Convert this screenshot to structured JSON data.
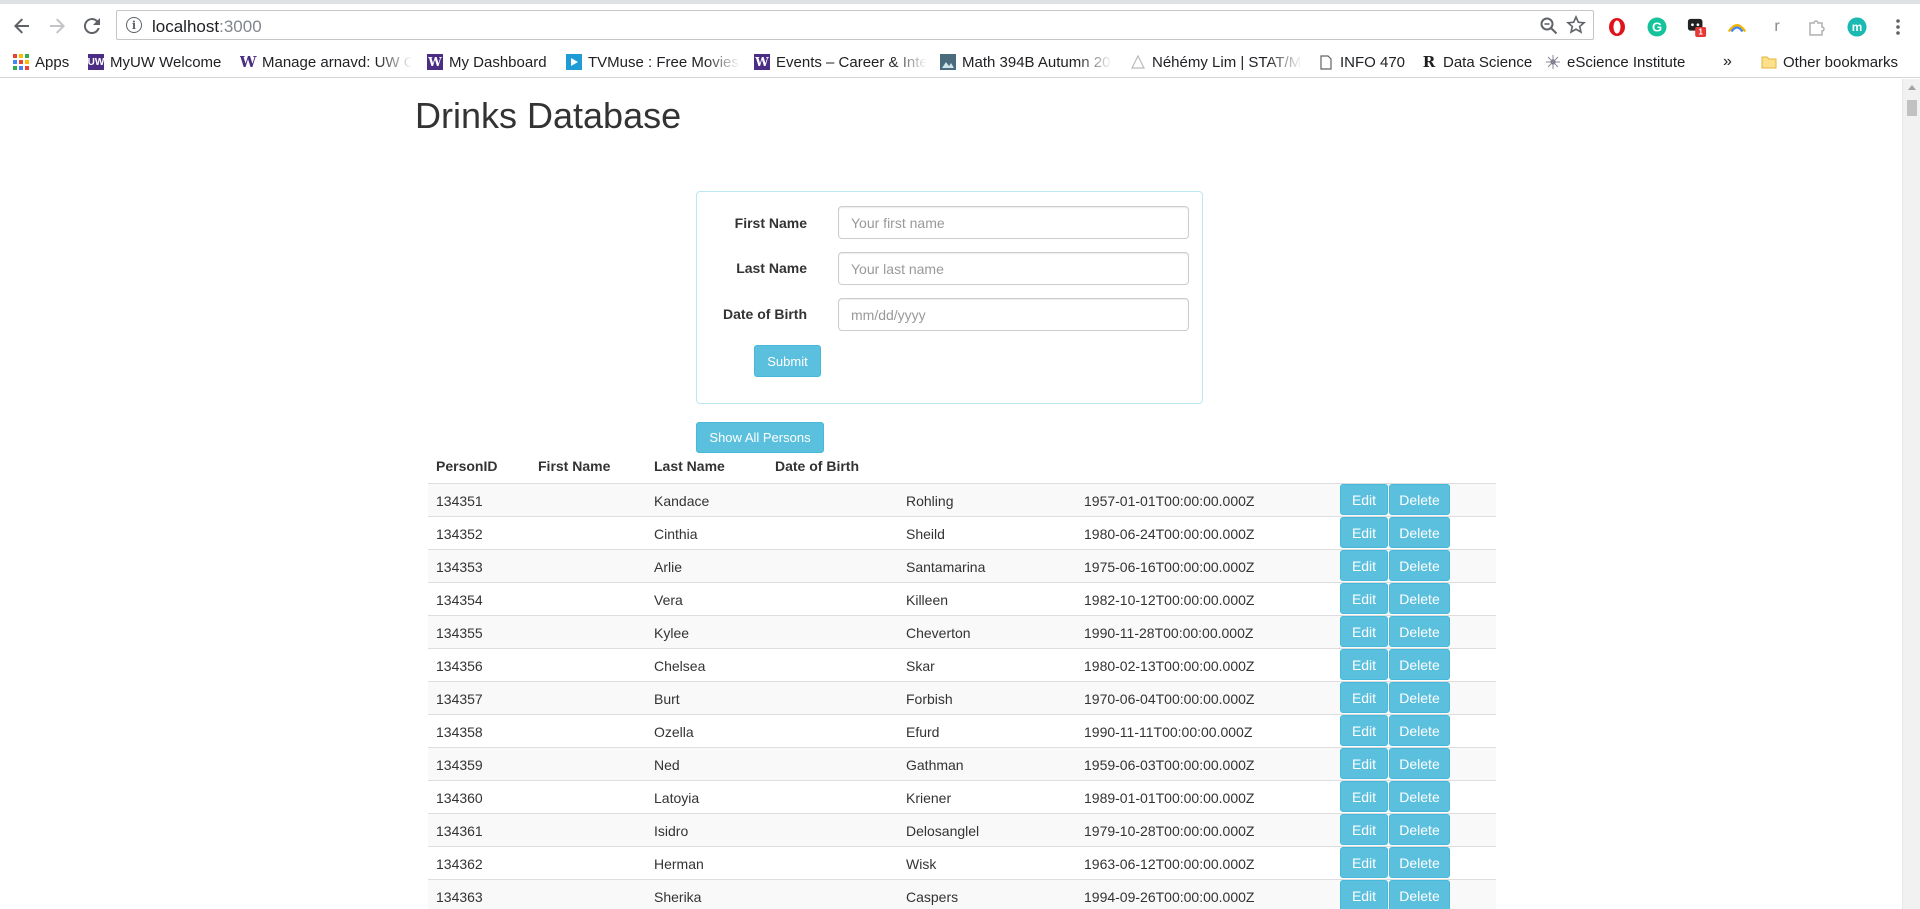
{
  "browser": {
    "url_host": "localhost",
    "url_port": ":3000",
    "bookmarks": [
      {
        "label": "Apps",
        "icon": "apps-grid-icon"
      },
      {
        "label": "MyUW Welcome",
        "icon": "uw-icon"
      },
      {
        "label": "Manage arnavd: UW C",
        "icon": "w-icon"
      },
      {
        "label": "My Dashboard",
        "icon": "w-icon"
      },
      {
        "label": "TVMuse : Free Movies",
        "icon": "play-icon"
      },
      {
        "label": "Events – Career & Inte",
        "icon": "w-icon"
      },
      {
        "label": "Math 394B Autumn 20",
        "icon": "image-icon"
      },
      {
        "label": "Néhémy Lim | STAT/M",
        "icon": "triangle-icon"
      },
      {
        "label": "INFO 470",
        "icon": "page-icon"
      },
      {
        "label": "Data Science",
        "icon": "r-icon"
      },
      {
        "label": "eScience Institute",
        "icon": "escience-icon"
      }
    ],
    "overflow_label": "»",
    "other_bookmarks": "Other bookmarks",
    "extension_badge": "1"
  },
  "page": {
    "title": "Drinks Database"
  },
  "form": {
    "first_name_label": "First Name",
    "first_name_placeholder": "Your first name",
    "last_name_label": "Last Name",
    "last_name_placeholder": "Your last name",
    "dob_label": "Date of Birth",
    "dob_placeholder": "mm/dd/yyyy",
    "submit_label": "Submit"
  },
  "show_all_label": "Show All Persons",
  "table": {
    "headers": [
      "PersonID",
      "First Name",
      "Last Name",
      "Date of Birth"
    ],
    "edit_label": "Edit",
    "delete_label": "Delete",
    "rows": [
      {
        "id": "134351",
        "first": "Kandace",
        "last": "Rohling",
        "dob": "1957-01-01T00:00:00.000Z"
      },
      {
        "id": "134352",
        "first": "Cinthia",
        "last": "Sheild",
        "dob": "1980-06-24T00:00:00.000Z"
      },
      {
        "id": "134353",
        "first": "Arlie",
        "last": "Santamarina",
        "dob": "1975-06-16T00:00:00.000Z"
      },
      {
        "id": "134354",
        "first": "Vera",
        "last": "Killeen",
        "dob": "1982-10-12T00:00:00.000Z"
      },
      {
        "id": "134355",
        "first": "Kylee",
        "last": "Cheverton",
        "dob": "1990-11-28T00:00:00.000Z"
      },
      {
        "id": "134356",
        "first": "Chelsea",
        "last": "Skar",
        "dob": "1980-02-13T00:00:00.000Z"
      },
      {
        "id": "134357",
        "first": "Burt",
        "last": "Forbish",
        "dob": "1970-06-04T00:00:00.000Z"
      },
      {
        "id": "134358",
        "first": "Ozella",
        "last": "Efurd",
        "dob": "1990-11-11T00:00:00.000Z"
      },
      {
        "id": "134359",
        "first": "Ned",
        "last": "Gathman",
        "dob": "1959-06-03T00:00:00.000Z"
      },
      {
        "id": "134360",
        "first": "Latoyia",
        "last": "Kriener",
        "dob": "1989-01-01T00:00:00.000Z"
      },
      {
        "id": "134361",
        "first": "Isidro",
        "last": "Delosanglel",
        "dob": "1979-10-28T00:00:00.000Z"
      },
      {
        "id": "134362",
        "first": "Herman",
        "last": "Wisk",
        "dob": "1963-06-12T00:00:00.000Z"
      },
      {
        "id": "134363",
        "first": "Sherika",
        "last": "Caspers",
        "dob": "1994-09-26T00:00:00.000Z"
      }
    ]
  },
  "colors": {
    "info_button": "#5bc0de",
    "panel_border": "#bce8f1",
    "stripe": "#f9f9f9"
  }
}
